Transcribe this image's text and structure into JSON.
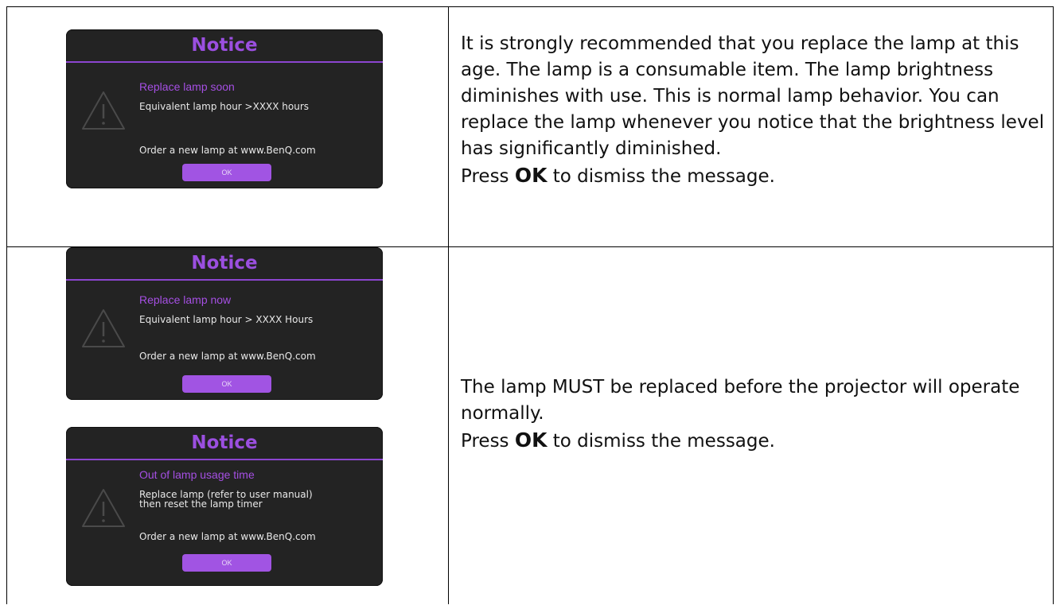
{
  "rows": [
    {
      "notices": [
        {
          "title": "Notice",
          "headline": "Replace lamp soon",
          "lines": [
            "Equivalent lamp hour >XXXX hours"
          ],
          "order": "Order a new lamp at www.BenQ.com",
          "ok_label": "OK"
        }
      ],
      "desc": [
        "It is strongly recommended that you replace the lamp at this age. The lamp is a consumable item. The lamp brightness diminishes with use. This is normal lamp behavior. You can replace the lamp whenever you notice that the brightness level has significantly diminished."
      ],
      "press_prefix": "Press ",
      "press_key": "OK",
      "press_suffix": " to dismiss the message."
    },
    {
      "notices": [
        {
          "title": "Notice",
          "headline": "Replace lamp now",
          "lines": [
            "Equivalent lamp hour > XXXX Hours"
          ],
          "order": "Order a new lamp at www.BenQ.com",
          "ok_label": "OK"
        },
        {
          "title": "Notice",
          "headline": "Out of lamp usage time",
          "lines": [
            "Replace lamp (refer to user manual)",
            "then reset the lamp timer"
          ],
          "order": "Order a new lamp at www.BenQ.com",
          "ok_label": "OK"
        }
      ],
      "desc": [
        "The lamp MUST be replaced before the projector will operate normally."
      ],
      "press_prefix": "Press ",
      "press_key": "OK",
      "press_suffix": " to dismiss the message."
    }
  ],
  "colors": {
    "dialog_bg": "#232323",
    "accent_purple": "#a154e3",
    "title_purple": "#9b4fe0"
  },
  "icons": {
    "warning": "warning-triangle-icon"
  }
}
